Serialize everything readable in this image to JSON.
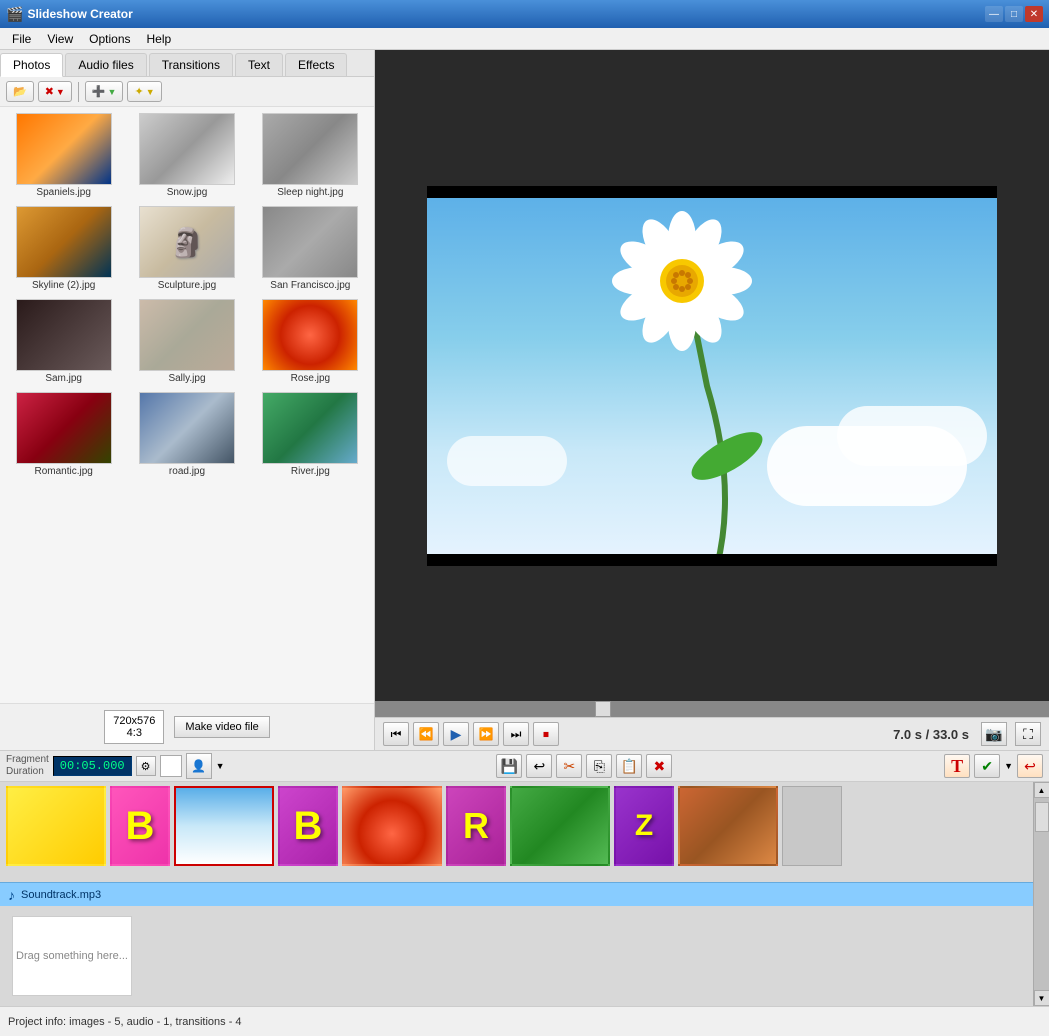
{
  "window": {
    "title": "Slideshow Creator",
    "icon": "🎬"
  },
  "titlebar": {
    "minimize": "—",
    "maximize": "□",
    "close": "✕"
  },
  "menu": {
    "items": [
      "File",
      "View",
      "Options",
      "Help"
    ]
  },
  "tabs": {
    "items": [
      "Photos",
      "Audio files",
      "Transitions",
      "Text",
      "Effects"
    ],
    "active": 0
  },
  "toolbar": {
    "open_label": "Open",
    "delete_label": "Delete",
    "add_label": "Add",
    "effects_label": "Effects"
  },
  "photos": [
    {
      "name": "Spaniels.jpg",
      "thumb_class": "thumb-sunset"
    },
    {
      "name": "Snow.jpg",
      "thumb_class": "thumb-sculpture"
    },
    {
      "name": "Sleep night.jpg",
      "thumb_class": "thumb-sf"
    },
    {
      "name": "Skyline (2).jpg",
      "thumb_class": "thumb-sunset"
    },
    {
      "name": "Sculpture.jpg",
      "thumb_class": "thumb-sculpture"
    },
    {
      "name": "San Francisco.jpg",
      "thumb_class": "thumb-sf"
    },
    {
      "name": "Sam.jpg",
      "thumb_class": "thumb-sam"
    },
    {
      "name": "Sally.jpg",
      "thumb_class": "thumb-sally"
    },
    {
      "name": "Rose.jpg",
      "thumb_class": "thumb-rose"
    },
    {
      "name": "Romantic.jpg",
      "thumb_class": "thumb-romantic"
    },
    {
      "name": "road.jpg",
      "thumb_class": "thumb-road"
    },
    {
      "name": "River.jpg",
      "thumb_class": "thumb-river"
    }
  ],
  "resolution": "720x576\n4:3",
  "make_video_btn": "Make\nvideo file",
  "fragment": {
    "label": "Fragment\nDuration",
    "time": "00:05.000"
  },
  "playback": {
    "time_current": "7.0 s",
    "time_total": "33.0 s",
    "separator": "/"
  },
  "timeline": {
    "items": [
      {
        "type": "photo",
        "thumb_class": "tl-daisy",
        "label": ""
      },
      {
        "type": "text",
        "letter": "B",
        "bg": "#ff66cc"
      },
      {
        "type": "photo",
        "thumb_class": "tl-daisy-sky",
        "label": "",
        "selected": true
      },
      {
        "type": "transition",
        "letter": "B",
        "bg": "#cc44cc"
      },
      {
        "type": "photo",
        "thumb_class": "tl-rose",
        "label": ""
      },
      {
        "type": "transition",
        "letter": "R",
        "bg": "#cc44cc"
      },
      {
        "type": "photo",
        "thumb_class": "tl-garden",
        "label": ""
      },
      {
        "type": "transition",
        "letter": "Z",
        "bg": "#9944cc"
      },
      {
        "type": "photo",
        "thumb_class": "tl-bee",
        "label": ""
      },
      {
        "type": "empty",
        "label": ""
      }
    ]
  },
  "audio": {
    "filename": "Soundtrack.mp3",
    "note_icon": "♪"
  },
  "drag_area": {
    "text": "Drag\nsomething here..."
  },
  "status": {
    "text": "Project info: images - 5, audio - 1, transitions - 4"
  }
}
